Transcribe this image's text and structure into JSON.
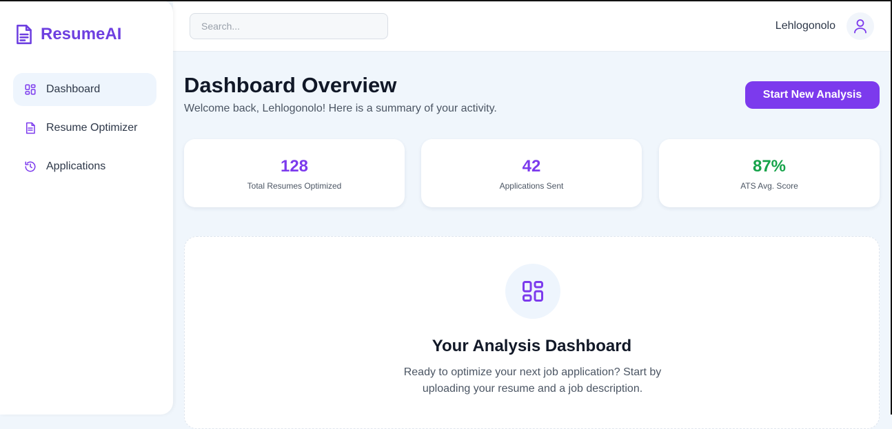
{
  "sidebar": {
    "brand": "ResumeAI",
    "items": [
      {
        "label": "Dashboard",
        "icon": "dashboard-icon",
        "active": true
      },
      {
        "label": "Resume Optimizer",
        "icon": "document-icon",
        "active": false
      },
      {
        "label": "Applications",
        "icon": "history-icon",
        "active": false
      }
    ]
  },
  "header": {
    "search_placeholder": "Search...",
    "user_name": "Lehlogonolo",
    "avatar_icon": "user-icon"
  },
  "main": {
    "title": "Dashboard Overview",
    "subtitle": "Welcome back, Lehlogonolo! Here is a summary of your activity.",
    "primary_action": "Start New Analysis",
    "stats": [
      {
        "value": "128",
        "label": "Total Resumes Optimized",
        "color": "#7c3aed"
      },
      {
        "value": "42",
        "label": "Applications Sent",
        "color": "#7c3aed"
      },
      {
        "value": "87%",
        "label": "ATS Avg. Score",
        "color": "#16a34a"
      }
    ],
    "panel": {
      "icon": "dashboard-icon",
      "title": "Your Analysis Dashboard",
      "text": "Ready to optimize your next job application? Start by uploading your resume and a job description."
    }
  },
  "colors": {
    "accent": "#7c3aed",
    "brand": "#6d3fe0",
    "success": "#16a34a"
  }
}
